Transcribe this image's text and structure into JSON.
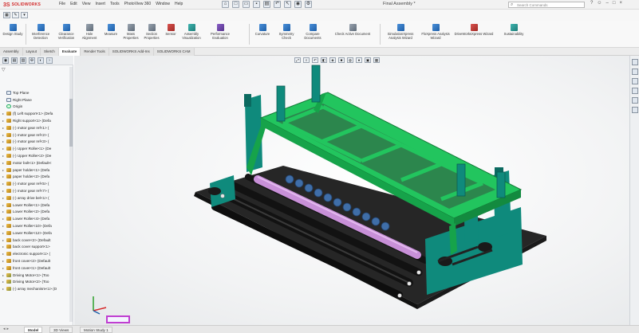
{
  "app": {
    "logo_text": "SOLIDWORKS",
    "menus": [
      "File",
      "Edit",
      "View",
      "Insert",
      "Tools",
      "PhotoView 360",
      "Window",
      "Help"
    ],
    "document_title": "Final Assembly *",
    "search_placeholder": "Search Commands"
  },
  "ribbon": {
    "design_study": "Design Study",
    "interference": "Interference Detection",
    "clearance": "Clearance Verification",
    "hole": "Hole Alignment",
    "measure": "Measure",
    "mass": "Mass Properties",
    "section": "Section Properties",
    "sensor": "Sensor",
    "asm_vis": "Assembly Visualization",
    "perf_eval": "Performance Evaluation",
    "curvature": "Curvature",
    "symmetry": "Symmetry Check",
    "compare": "Compare Documents",
    "check_active": "Check Active Document",
    "sim_xpress": "SimulationXpress Analysis Wizard",
    "flo_xpress": "FloXpress Analysis Wizard",
    "drive_works": "DriveWorksXpress Wizard",
    "sustainability": "Sustainability"
  },
  "tabs": [
    "Assembly",
    "Layout",
    "Sketch",
    "Evaluate",
    "Render Tools",
    "SOLIDWORKS Add-Ins",
    "SOLIDWORKS CAM"
  ],
  "active_tab_index": 3,
  "tree": [
    {
      "label": "Top Plane",
      "icon": "plane"
    },
    {
      "label": "Right Plane",
      "icon": "plane"
    },
    {
      "label": "Origin",
      "icon": "origin"
    },
    {
      "label": "(f) Left support<1> (Defa",
      "icon": "part"
    },
    {
      "label": "Right support<1> (Defa",
      "icon": "part"
    },
    {
      "label": "(-) motor gear ref<1> (",
      "icon": "part"
    },
    {
      "label": "(-) motor gear ref<2> (",
      "icon": "part"
    },
    {
      "label": "(-) motor gear ref<3> (",
      "icon": "part"
    },
    {
      "label": "(-) Upper Roller<1> (De",
      "icon": "part"
    },
    {
      "label": "(-) Upper Roller<2> (De",
      "icon": "part"
    },
    {
      "label": "motor bolt<1> (Default<",
      "icon": "part"
    },
    {
      "label": "paper holder<1> (Defa",
      "icon": "part"
    },
    {
      "label": "paper holder<2> (Defa",
      "icon": "part"
    },
    {
      "label": "(-) motor gear ref<5> (",
      "icon": "part"
    },
    {
      "label": "(-) motor gear ref<7> (",
      "icon": "part"
    },
    {
      "label": "(-) array drive bel<1> (",
      "icon": "part"
    },
    {
      "label": "Lower Roller<1> (Defa",
      "icon": "part"
    },
    {
      "label": "Lower Roller<2> (Defa",
      "icon": "part"
    },
    {
      "label": "Lower Roller<4> (Defa",
      "icon": "part"
    },
    {
      "label": "Lower Roller<10> (Defa",
      "icon": "part"
    },
    {
      "label": "Lower Roller<12> (Defa",
      "icon": "part"
    },
    {
      "label": "back cover<2> (Default",
      "icon": "part"
    },
    {
      "label": "back cover support<1>",
      "icon": "part"
    },
    {
      "label": "electronic support<1> (",
      "icon": "part"
    },
    {
      "label": "front cover<2> (Default",
      "icon": "part"
    },
    {
      "label": "front cover<1> (Default",
      "icon": "part"
    },
    {
      "label": "Driving Motor<1> (Too",
      "icon": "asm"
    },
    {
      "label": "Driving Motor<2> (Too",
      "icon": "asm"
    },
    {
      "label": "(-) array mechanism<1> (D",
      "icon": "asm"
    }
  ],
  "bottom_tabs": [
    "Model",
    "3D Views",
    "Motion Study 1"
  ],
  "active_bottom_tab_index": 0,
  "colors": {
    "frame_green": "#22c55e",
    "frame_teal": "#0f8a7c",
    "roller_dark": "#1d1d1d",
    "roller_pink": "#c890d8",
    "base_dark": "#262626",
    "orientation_magenta": "#c03ed1"
  }
}
